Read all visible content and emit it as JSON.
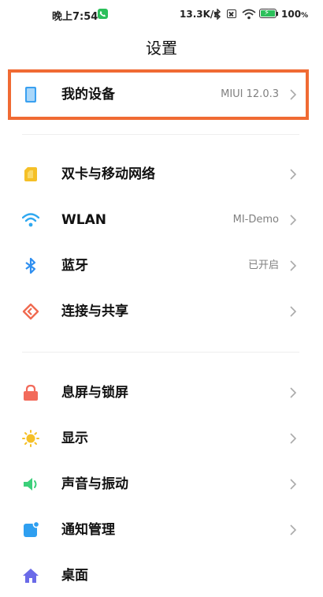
{
  "status_bar": {
    "time": "晚上7:54",
    "net_speed": "13.3K/s",
    "battery_pct": "100",
    "battery_unit": "%",
    "icons": [
      "phone-call-icon",
      "bluetooth-icon",
      "no-sim-icon",
      "wifi-icon",
      "battery-charging-icon"
    ]
  },
  "header": {
    "title": "设置"
  },
  "sections": [
    {
      "items": [
        {
          "label": "我的设备",
          "value": "MIUI 12.0.3",
          "icon": "device-icon"
        }
      ]
    },
    {
      "items": [
        {
          "label": "双卡与移动网络",
          "value": "",
          "icon": "sim-card-icon"
        },
        {
          "label": "WLAN",
          "value": "MI-Demo",
          "icon": "wifi-icon"
        },
        {
          "label": "蓝牙",
          "value": "已开启",
          "icon": "bluetooth-icon"
        },
        {
          "label": "连接与共享",
          "value": "",
          "icon": "share-icon"
        }
      ]
    },
    {
      "items": [
        {
          "label": "息屏与锁屏",
          "value": "",
          "icon": "lock-icon"
        },
        {
          "label": "显示",
          "value": "",
          "icon": "brightness-icon"
        },
        {
          "label": "声音与振动",
          "value": "",
          "icon": "speaker-icon"
        },
        {
          "label": "通知管理",
          "value": "",
          "icon": "notification-icon"
        },
        {
          "label": "桌面",
          "value": "",
          "icon": "home-icon"
        }
      ]
    }
  ],
  "colors": {
    "highlight": "#f06a33",
    "device": "#3aa0f0",
    "sim": "#f5c027",
    "wifi": "#2fa8f0",
    "bluetooth": "#2f8ff0",
    "share": "#f06a50",
    "lock": "#f26b5b",
    "brightness": "#f5c027",
    "speaker": "#3ccf7a",
    "notification": "#2f9ff0",
    "home": "#6a6ae8"
  }
}
